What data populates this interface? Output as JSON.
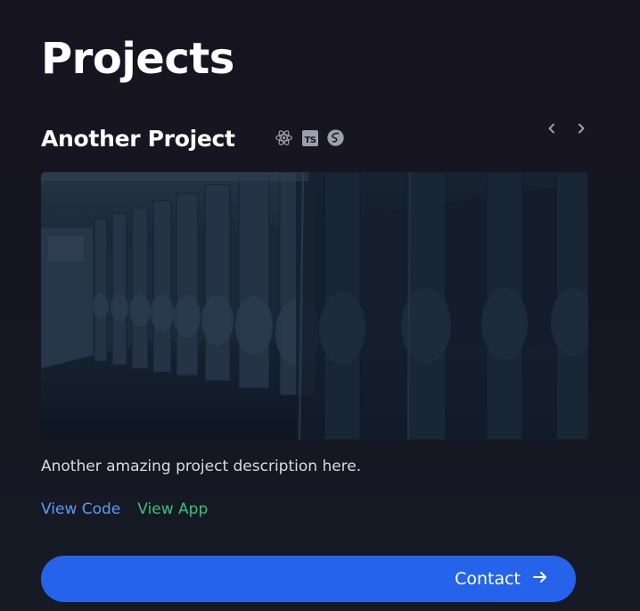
{
  "page": {
    "title": "Projects"
  },
  "project": {
    "title": "Another Project",
    "tech_icons": [
      "react-icon",
      "typescript-icon",
      "sass-icon"
    ],
    "ts_badge": "TS",
    "image_icon": "corridor-photo",
    "description": "Another amazing project description here.",
    "links": {
      "code": "View Code",
      "app": "View App"
    }
  },
  "carousel": {
    "prev_icon": "chevron-left-icon",
    "next_icon": "chevron-right-icon"
  },
  "contact": {
    "label": "Contact",
    "icon": "arrow-right-icon"
  },
  "colors": {
    "accent": "#2563eb",
    "link_code": "#5b9bf5",
    "link_app": "#37c27a",
    "background": "#16141f"
  }
}
